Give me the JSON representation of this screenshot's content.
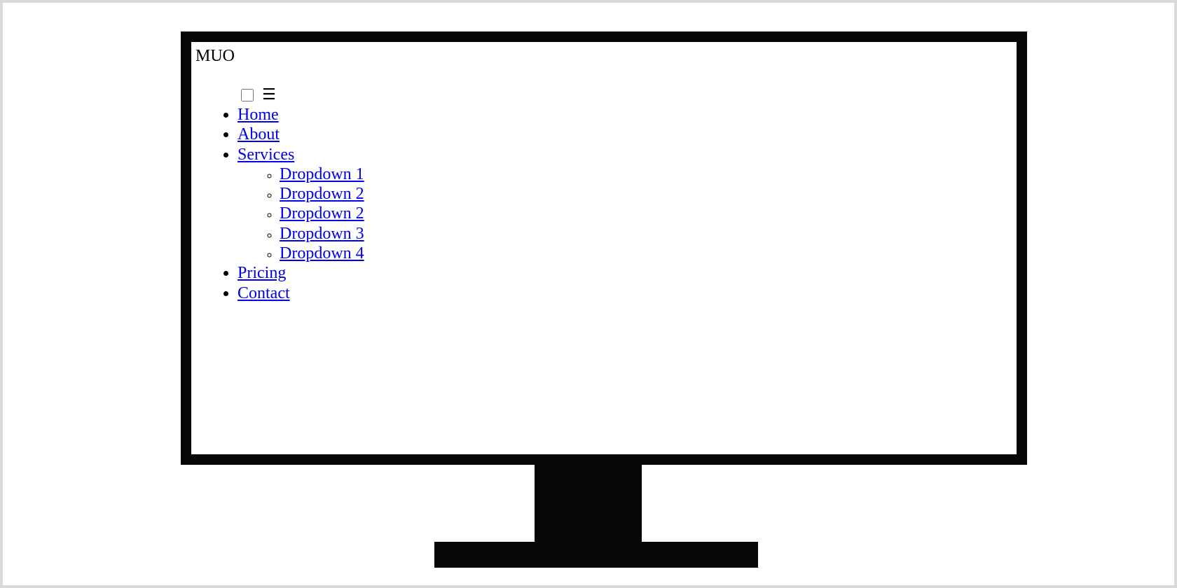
{
  "logo": "MUO",
  "nav": {
    "toggle_checkbox_checked": false,
    "hamburger_icon": "☰",
    "items": [
      {
        "label": "Home"
      },
      {
        "label": "About"
      },
      {
        "label": "Services",
        "children": [
          {
            "label": "Dropdown 1"
          },
          {
            "label": "Dropdown 2"
          },
          {
            "label": "Dropdown 2"
          },
          {
            "label": "Dropdown 3"
          },
          {
            "label": "Dropdown 4"
          }
        ]
      },
      {
        "label": "Pricing"
      },
      {
        "label": "Contact"
      }
    ]
  },
  "colors": {
    "frame": "#070605",
    "link": "#0000ee",
    "page_border": "#d9d9d9"
  }
}
